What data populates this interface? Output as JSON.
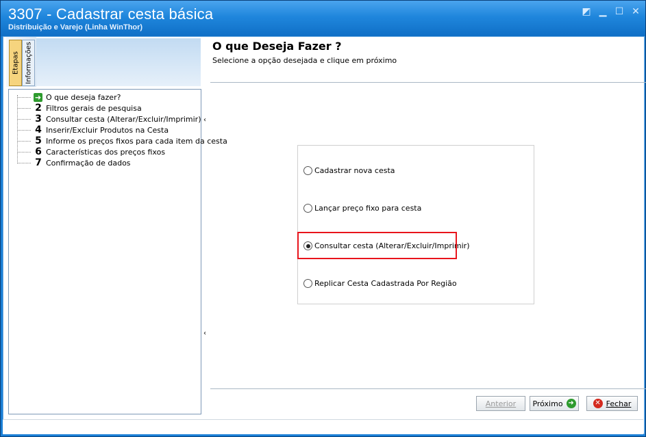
{
  "window": {
    "title": "3307 - Cadastrar cesta básica",
    "subtitle": "Distribuição e Varejo (Linha WinThor)"
  },
  "left": {
    "tabs": [
      "Etapas",
      "Informações"
    ],
    "steps": [
      {
        "num": "",
        "label": "O que deseja fazer?"
      },
      {
        "num": "2",
        "label": "Filtros gerais de pesquisa"
      },
      {
        "num": "3",
        "label": "Consultar cesta (Alterar/Excluir/Imprimir)"
      },
      {
        "num": "4",
        "label": "Inserir/Excluir Produtos na Cesta"
      },
      {
        "num": "5",
        "label": "Informe os preços fixos para cada item da cesta"
      },
      {
        "num": "6",
        "label": "Características dos preços fixos"
      },
      {
        "num": "7",
        "label": "Confirmação de dados"
      }
    ]
  },
  "main": {
    "title": "O que Deseja Fazer ?",
    "subtitle": "Selecione a opção desejada e clique em próximo",
    "options": [
      {
        "label": "Cadastrar nova cesta",
        "selected": false
      },
      {
        "label": "Lançar preço fixo para cesta",
        "selected": false
      },
      {
        "label": "Consultar cesta (Alterar/Excluir/Imprimir)",
        "selected": true
      },
      {
        "label": "Replicar Cesta Cadastrada Por Região",
        "selected": false
      }
    ],
    "highlight_color": "#e8141b"
  },
  "buttons": {
    "anterior": "Anterior",
    "proximo": "Próximo",
    "fechar": "Fechar"
  },
  "colors": {
    "title_bar": "#1f86dc",
    "next_icon": "#2e9b2e",
    "close_icon": "#d42a1e"
  }
}
